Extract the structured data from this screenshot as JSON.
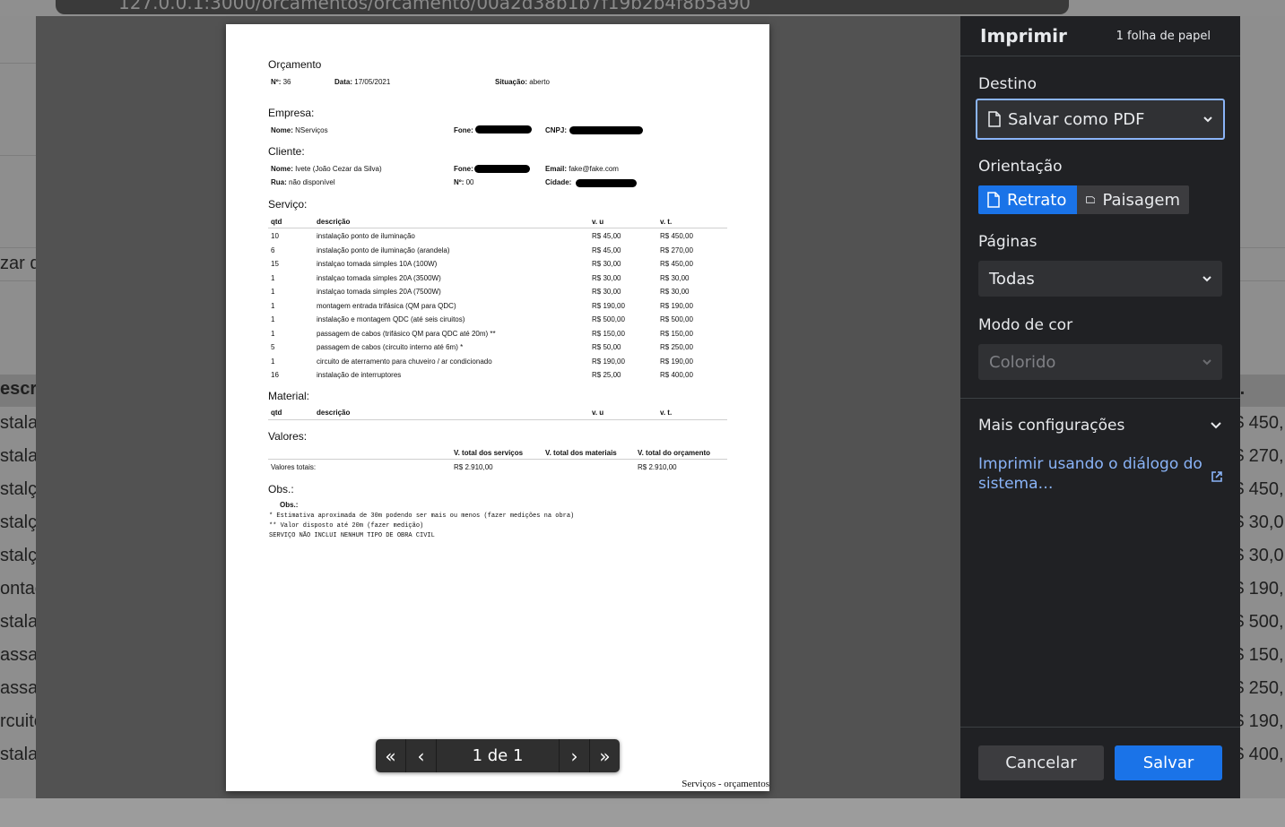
{
  "browser": {
    "url": "127.0.0.1:3000/orcamentos/orcamento/00a2d38b1b7f19b2b4f8b5a90"
  },
  "background": {
    "left_fragments": [
      "zar d",
      "escri",
      "stalaç",
      "stalaç",
      "stalç",
      "stalç",
      "stalç",
      "ontag",
      "stalaç",
      "assag",
      "assag",
      "rcuito",
      "stalaç"
    ],
    "right_fragments": [
      "t.",
      "$ 450,",
      "$ 270,",
      "$ 450,",
      "$ 30,0",
      "$ 30,0",
      "$ 190,",
      "$ 500,",
      "$ 150,",
      "$ 250,",
      "$ 190,",
      "$ 400,"
    ]
  },
  "document": {
    "title": "Orçamento",
    "numero_label": "Nº:",
    "numero": "36",
    "data_label": "Data:",
    "data": "17/05/2021",
    "situacao_label": "Situação:",
    "situacao": "aberto",
    "empresa": {
      "heading": "Empresa:",
      "nome_label": "Nome:",
      "nome": "NServiços",
      "fone_label": "Fone:",
      "cnpj_label": "CNPJ:"
    },
    "cliente": {
      "heading": "Cliente:",
      "nome_label": "Nome:",
      "nome": "Ivete (João Cezar da Silva)",
      "fone_label": "Fone:",
      "email_label": "Email:",
      "email": "fake@fake.com",
      "rua_label": "Rua:",
      "rua": "não disponível",
      "numero_label": "Nº:",
      "numero": "00",
      "cidade_label": "Cidade:"
    },
    "servico": {
      "heading": "Serviço:",
      "columns": [
        "qtd",
        "descrição",
        "v. u",
        "v. t."
      ],
      "rows": [
        [
          "10",
          "instalação ponto de iluminação",
          "R$ 45,00",
          "R$ 450,00"
        ],
        [
          "6",
          "instalação ponto de iluminação (arandela)",
          "R$ 45,00",
          "R$ 270,00"
        ],
        [
          "15",
          "instalçao tomada simples 10A (100W)",
          "R$ 30,00",
          "R$ 450,00"
        ],
        [
          "1",
          "instalçao tomada simples 20A (3500W)",
          "R$ 30,00",
          "R$ 30,00"
        ],
        [
          "1",
          "instalçao tomada simples 20A (7500W)",
          "R$ 30,00",
          "R$ 30,00"
        ],
        [
          "1",
          "montagem entrada trifásica (QM para QDC)",
          "R$ 190,00",
          "R$ 190,00"
        ],
        [
          "1",
          "instalação e montagem QDC (até seis ciruitos)",
          "R$ 500,00",
          "R$ 500,00"
        ],
        [
          "1",
          "passagem de cabos (trifásico QM para QDC até 20m) **",
          "R$ 150,00",
          "R$ 150,00"
        ],
        [
          "5",
          "passagem de cabos (circuito interno até 6m) *",
          "R$ 50,00",
          "R$ 250,00"
        ],
        [
          "1",
          "circuito de aterramento para chuveiro / ar condicionado",
          "R$ 190,00",
          "R$ 190,00"
        ],
        [
          "16",
          "instalação de interruptores",
          "R$ 25,00",
          "R$ 400,00"
        ]
      ]
    },
    "material": {
      "heading": "Material:",
      "columns": [
        "qtd",
        "descrição",
        "v. u",
        "v. t."
      ]
    },
    "valores": {
      "heading": "Valores:",
      "col_servicos": "V. total dos serviços",
      "col_materiais": "V. total dos materiais",
      "col_orcamento": "V. total do orçamento",
      "row_label": "Valores totais:",
      "total_servicos": "R$ 2.910,00",
      "total_orcamento": "R$ 2.910,00"
    },
    "obs": {
      "heading": "Obs.:",
      "sub_label": "Obs.:",
      "lines": [
        "* Estimativa aproximada de 30m podendo ser mais ou menos (fazer medições na obra)",
        "** Valor disposto até 20m (fazer medição)",
        "SERVIÇO NÃO INCLUI NENHUM TIPO DE OBRA CIVIL"
      ]
    },
    "footer": "Serviços - orçamentos"
  },
  "pager": {
    "label": "1 de 1",
    "first": "«",
    "prev": "‹",
    "next": "›",
    "last": "»"
  },
  "print_panel": {
    "title": "Imprimir",
    "sheets": "1 folha de papel",
    "destino_label": "Destino",
    "destino_value": "Salvar como PDF",
    "orientacao_label": "Orientação",
    "retrato": "Retrato",
    "paisagem": "Paisagem",
    "paginas_label": "Páginas",
    "paginas_value": "Todas",
    "modo_cor_label": "Modo de cor",
    "modo_cor_value": "Colorido",
    "mais_config": "Mais configurações",
    "system_dialog_link": "Imprimir usando o diálogo do sistema…",
    "cancel": "Cancelar",
    "save": "Salvar",
    "accent": "#1a73e8"
  }
}
